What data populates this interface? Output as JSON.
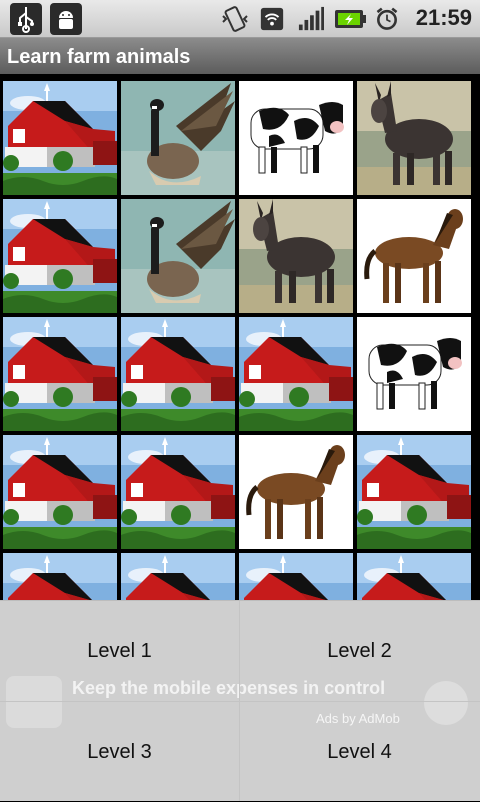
{
  "status_bar": {
    "time": "21:59",
    "icons": [
      "usb-icon",
      "android-debug-icon",
      "vibrate-icon",
      "wifi-icon",
      "signal-icon",
      "battery-charging-icon",
      "alarm-icon"
    ]
  },
  "app": {
    "title": "Learn farm animals"
  },
  "grid": {
    "tiles": [
      "barn",
      "goose",
      "cow",
      "donkey",
      "barn",
      "goose",
      "donkey",
      "horse",
      "barn",
      "barn",
      "barn",
      "cow",
      "barn",
      "barn",
      "horse",
      "barn",
      "barn",
      "barn",
      "barn",
      "barn"
    ]
  },
  "ad": {
    "text": "Keep the mobile expenses in control",
    "sub": "Ads by AdMob"
  },
  "menu": {
    "items": [
      {
        "label": "Level 1"
      },
      {
        "label": "Level 2"
      },
      {
        "label": "Level 3"
      },
      {
        "label": "Level 4"
      }
    ]
  }
}
